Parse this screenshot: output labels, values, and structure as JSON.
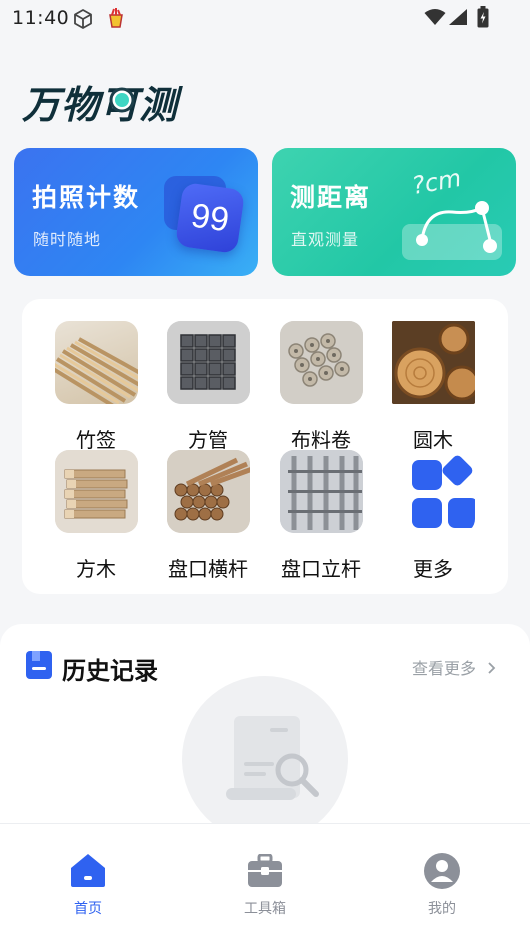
{
  "status": {
    "time": "11:40"
  },
  "app": {
    "logo_text": "万物可测"
  },
  "cards": [
    {
      "title": "拍照计数",
      "subtitle": "随时随地",
      "badge": "99"
    },
    {
      "title": "测距离",
      "subtitle": "直观测量",
      "tag": "?cm"
    }
  ],
  "categories": [
    {
      "label": "竹签"
    },
    {
      "label": "方管"
    },
    {
      "label": "布料卷"
    },
    {
      "label": "圆木"
    },
    {
      "label": "方木"
    },
    {
      "label": "盘口横杆"
    },
    {
      "label": "盘口立杆"
    },
    {
      "label": "更多"
    }
  ],
  "history": {
    "title": "历史记录",
    "more": "查看更多"
  },
  "tabs": [
    {
      "label": "首页",
      "active": true
    },
    {
      "label": "工具箱",
      "active": false
    },
    {
      "label": "我的",
      "active": false
    }
  ],
  "colors": {
    "accent": "#2f62f0",
    "inactive": "#8c9099"
  }
}
